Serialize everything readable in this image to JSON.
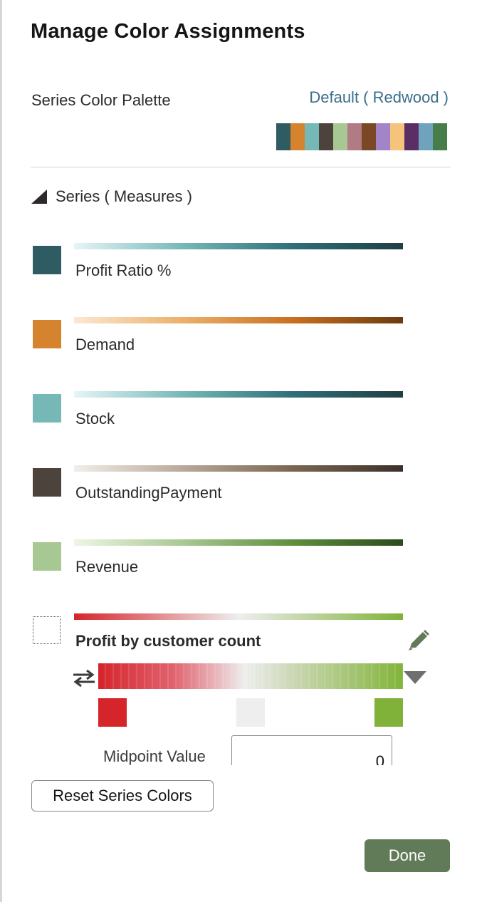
{
  "dialog": {
    "title": "Manage Color Assignments",
    "palette_label": "Series Color Palette",
    "palette_value": "Default ( Redwood )",
    "palette_swatches": [
      "#2f5c63",
      "#d6832f",
      "#75b8b5",
      "#4b433c",
      "#a8c893",
      "#b07b84",
      "#7a4825",
      "#a284c8",
      "#f5c37c",
      "#5a2d64",
      "#6fa2bc",
      "#477d4b"
    ],
    "series_section_label": "Series ( Measures )",
    "series": [
      {
        "name": "Profit Ratio %",
        "color": "#2f5c63",
        "gradient": [
          "#e6f5f9",
          "#75b8b5",
          "#2f6e7a",
          "#1f3f42"
        ]
      },
      {
        "name": "Demand",
        "color": "#d6832f",
        "gradient": [
          "#fbe8d2",
          "#ecb06a",
          "#c96f1f",
          "#6b3a0f"
        ]
      },
      {
        "name": "Stock",
        "color": "#75b8b5",
        "gradient": [
          "#e6f5f9",
          "#75b8b5",
          "#2f6e7a",
          "#1f3f42"
        ]
      },
      {
        "name": "OutstandingPayment",
        "color": "#4b433c",
        "gradient": [
          "#f2eeea",
          "#b8a898",
          "#7a6650",
          "#3b302a"
        ]
      },
      {
        "name": "Revenue",
        "color": "#a8c893",
        "gradient": [
          "#eef6e4",
          "#a8c893",
          "#5f8f3c",
          "#2c4a1c"
        ]
      }
    ],
    "diverging_series": {
      "name": "Profit by customer count",
      "gradient": [
        "#d6242b",
        "#eeeeee",
        "#80b23a"
      ],
      "stops": [
        "#d6242b",
        "#eeeeee",
        "#80b23a"
      ],
      "midpoint_label": "Midpoint Value",
      "midpoint_value": "0"
    },
    "reset_label": "Reset Series Colors",
    "done_label": "Done"
  }
}
